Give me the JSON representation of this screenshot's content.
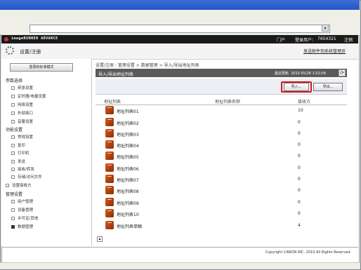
{
  "header": {
    "brand": "imageRUNNER ADVANCE",
    "portal_label": "门户",
    "login_user_label": "登录用户：",
    "login_user_value": "7654321",
    "logout_label": "注销",
    "page_title": "设置/注册",
    "send_link": "发送邮件到系统管理员"
  },
  "sidebar": {
    "standard_mode_label": "登录的标准模式",
    "sections": [
      {
        "title": "参数选择",
        "items": [
          {
            "label": "纸张设置"
          },
          {
            "label": "定时器/电量设置"
          },
          {
            "label": "网络设置"
          },
          {
            "label": "外部接口"
          },
          {
            "label": "音量设置"
          }
        ]
      },
      {
        "title": "功能设置",
        "items": [
          {
            "label": "常规设置"
          },
          {
            "label": "复印"
          },
          {
            "label": "打印机"
          },
          {
            "label": "发送"
          },
          {
            "label": "接收/转发"
          },
          {
            "label": "存储/访问文件"
          }
        ]
      },
      {
        "title": "",
        "items": [
          {
            "label": "设置接收方"
          }
        ]
      },
      {
        "title": "管理设置",
        "items": [
          {
            "label": "用户管理"
          },
          {
            "label": "设备管理"
          },
          {
            "label": "许可证/其他"
          },
          {
            "label": "数据管理",
            "active": true
          }
        ]
      }
    ]
  },
  "breadcrumb": "设置/注册 : 管理设置 > 数据管理 > 导入/导出地址列表",
  "panel": {
    "title": "导入/导出地址列表",
    "updated_label": "最近更新",
    "updated_value": "2010 05/26 1:52:09",
    "import_button": "导入...",
    "export_button": "导出..."
  },
  "table": {
    "columns": [
      "地址列表",
      "地址列表名称",
      "接收方"
    ],
    "rows": [
      {
        "name": "地址列表01",
        "count": "10"
      },
      {
        "name": "地址列表02",
        "count": "0"
      },
      {
        "name": "地址列表03",
        "count": "0"
      },
      {
        "name": "地址列表04",
        "count": "0"
      },
      {
        "name": "地址列表05",
        "count": "0"
      },
      {
        "name": "地址列表06",
        "count": "0"
      },
      {
        "name": "地址列表07",
        "count": "0"
      },
      {
        "name": "地址列表08",
        "count": "0"
      },
      {
        "name": "地址列表09",
        "count": "0"
      },
      {
        "name": "地址列表10",
        "count": "0"
      },
      {
        "name": "地址列表单触",
        "count": "4"
      }
    ]
  },
  "footer": {
    "copyright": "Copyright CANON INC. 2010 All Rights Reserved."
  },
  "colors": {
    "highlight": "#d8161e",
    "panel_header": "#5b5b5b",
    "top_bar": "#1a1a1a"
  }
}
